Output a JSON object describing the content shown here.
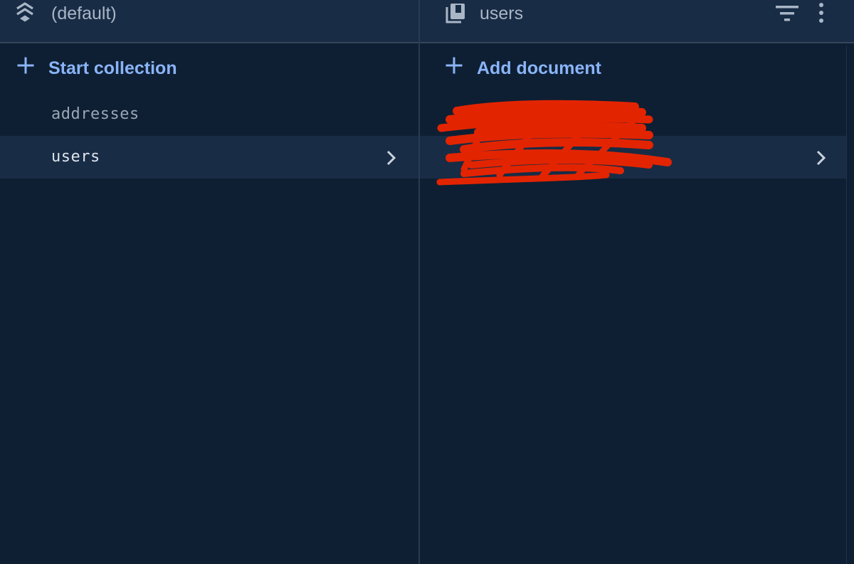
{
  "left_panel": {
    "title": "(default)",
    "title_icon": "firestore-database-icon",
    "add_label": "Start collection",
    "collections": [
      {
        "label": "addresses",
        "selected": false
      },
      {
        "label": "users",
        "selected": true
      }
    ]
  },
  "right_panel": {
    "title": "users",
    "title_icon": "collection-icon",
    "add_label": "Add document",
    "documents": [
      {
        "label": "",
        "selected": false,
        "redacted": true
      },
      {
        "label": "",
        "selected": true,
        "redacted": true
      }
    ],
    "actions": [
      "filter-icon",
      "more-vert-icon"
    ]
  },
  "colors": {
    "background": "#0e1f33",
    "header": "#182c45",
    "accent": "#8ab4f8",
    "text_muted": "#9aa6b4",
    "text_selected": "#dde4ec",
    "redaction": "#e32400"
  }
}
